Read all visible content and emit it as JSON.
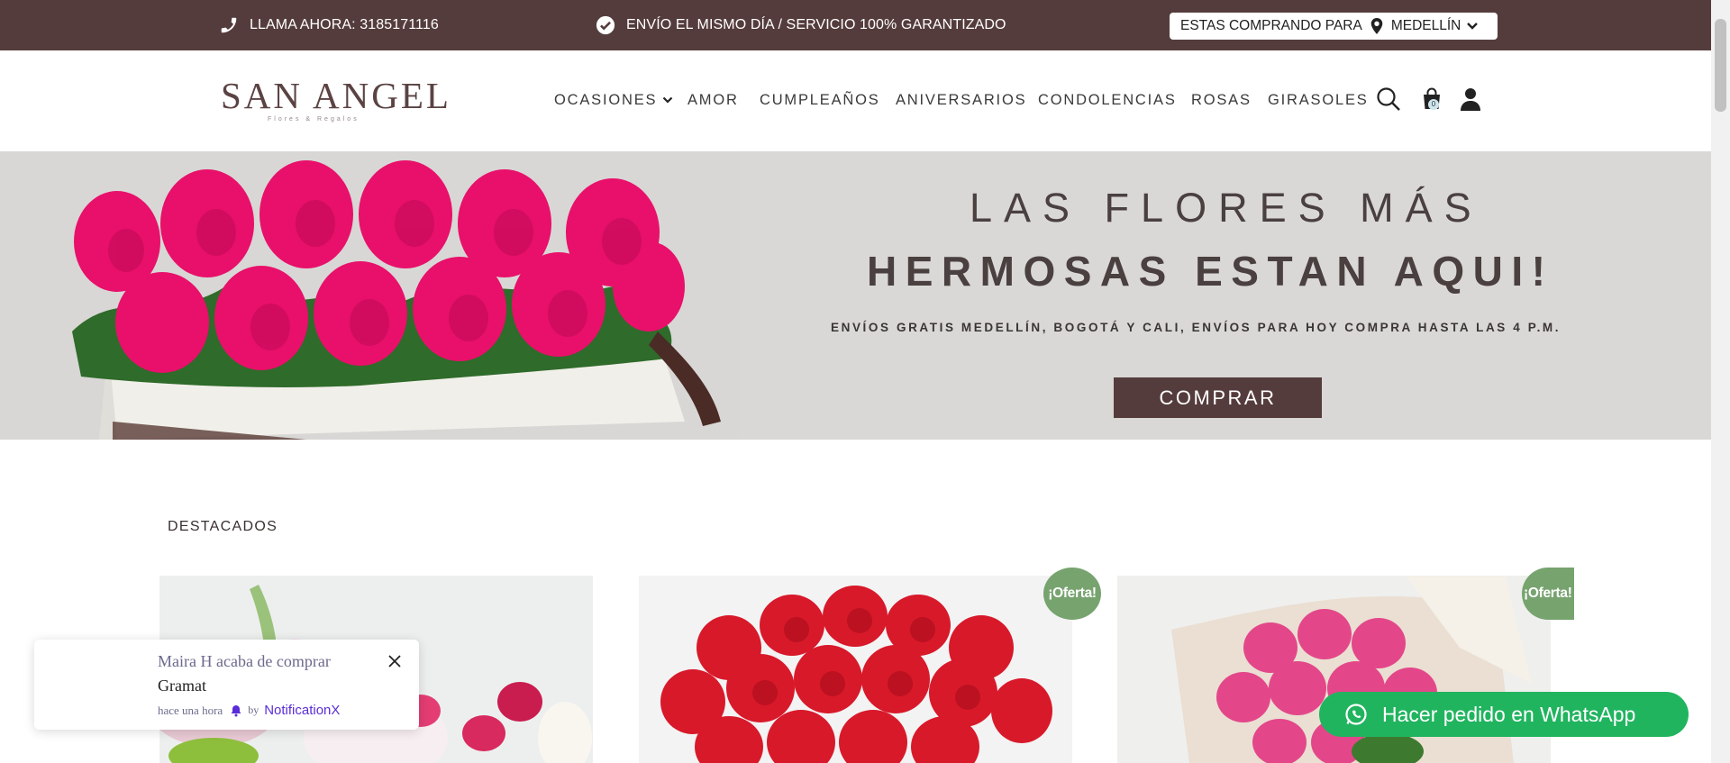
{
  "topbar": {
    "phone_text": "LLAMA AHORA: 3185171116",
    "shipping_text": "ENVÍO EL MISMO DÍA / SERVICIO 100% GARANTIZADO",
    "location_prefix": "ESTAS COMPRANDO PARA",
    "location_city": "MEDELLÍN",
    "icons": {
      "phone": "phone-icon",
      "check": "check-circle-icon",
      "pin": "map-pin-icon",
      "chevron": "chevron-down-icon"
    },
    "bg_color": "#553c3c"
  },
  "header": {
    "logo_main": "SAN ANGEL",
    "logo_sub": "Flores & Regalos",
    "nav": [
      "OCASIONES",
      "AMOR",
      "CUMPLEAÑOS",
      "ANIVERSARIOS",
      "CONDOLENCIAS",
      "ROSAS",
      "GIRASOLES"
    ],
    "cart_count": "0",
    "icons": {
      "search": "search-icon",
      "cart": "shopping-bag-icon",
      "account": "user-icon"
    }
  },
  "hero": {
    "title_line1": "LAS FLORES MÁS",
    "title_line2": "HERMOSAS ESTAN AQUI!",
    "subtitle": "ENVÍOS GRATIS MEDELLÍN, BOGOTÁ Y CALI, ENVÍOS PARA HOY COMPRA HASTA LAS 4 P.M.",
    "button_label": "COMPRAR",
    "button_color": "#553c3c"
  },
  "section": {
    "title": "DESTACADOS",
    "badges": [
      "¡Oferta!",
      "¡Oferta!"
    ],
    "badge_color": "#77a36f"
  },
  "notification": {
    "line1": "Maira H acaba de comprar",
    "line2": "Gramat",
    "time": "hace una hora",
    "by": "by",
    "brand": "NotificationX"
  },
  "whatsapp": {
    "label": "Hacer pedido en WhatsApp",
    "color": "#21b45f"
  }
}
